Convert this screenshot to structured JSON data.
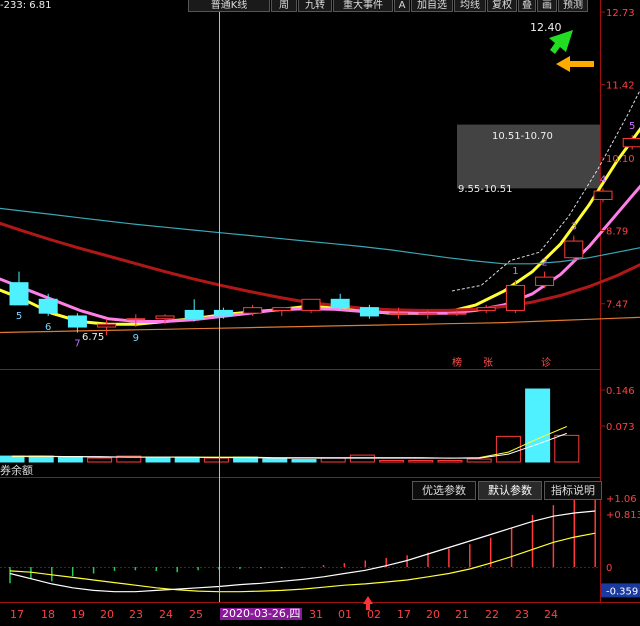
{
  "toolbar": {
    "price_display": "-233: 6.81",
    "buttons": [
      "普通K线",
      "周",
      "九转",
      "重大事件",
      "A",
      "加自选",
      "均线",
      "复权",
      "叠",
      "画",
      "预测"
    ]
  },
  "colors": {
    "bg": "#000000",
    "up": "#ff3b3b",
    "down": "#4ff0ff",
    "ma_yellow": "#ffff33",
    "ma_pink": "#ff7fe8",
    "ma_darkred": "#b01818",
    "ma_teal": "#3aa6b6",
    "ma_orange": "#e07a30",
    "axis_text": "#ff4040",
    "divider": "#a01010"
  },
  "chart_data": [
    {
      "type": "candlestick",
      "title": "",
      "ylim": [
        6.6,
        12.73
      ],
      "y_axis_labels": [
        "12.73",
        "11.42",
        "10.10",
        "8.79",
        "7.47"
      ],
      "y_ticks": [
        12.73,
        11.42,
        10.1,
        8.79,
        7.47
      ],
      "candles": [
        {
          "o": 7.85,
          "h": 8.05,
          "l": 7.45,
          "c": 7.45
        },
        {
          "o": 7.55,
          "h": 7.65,
          "l": 7.25,
          "c": 7.3
        },
        {
          "o": 7.25,
          "h": 7.3,
          "l": 6.95,
          "c": 7.05
        },
        {
          "o": 7.05,
          "h": 7.2,
          "l": 6.9,
          "c": 7.1
        },
        {
          "o": 7.2,
          "h": 7.28,
          "l": 7.05,
          "c": 7.2
        },
        {
          "o": 7.2,
          "h": 7.28,
          "l": 7.1,
          "c": 7.25
        },
        {
          "o": 7.35,
          "h": 7.55,
          "l": 7.15,
          "c": 7.2
        },
        {
          "o": 7.35,
          "h": 7.4,
          "l": 7.2,
          "c": 7.25
        },
        {
          "o": 7.3,
          "h": 7.45,
          "l": 7.25,
          "c": 7.4
        },
        {
          "o": 7.35,
          "h": 7.4,
          "l": 7.25,
          "c": 7.4
        },
        {
          "o": 7.35,
          "h": 7.5,
          "l": 7.3,
          "c": 7.55
        },
        {
          "o": 7.55,
          "h": 7.65,
          "l": 7.35,
          "c": 7.4
        },
        {
          "o": 7.4,
          "h": 7.45,
          "l": 7.2,
          "c": 7.25
        },
        {
          "o": 7.3,
          "h": 7.4,
          "l": 7.2,
          "c": 7.3
        },
        {
          "o": 7.3,
          "h": 7.35,
          "l": 7.2,
          "c": 7.3
        },
        {
          "o": 7.3,
          "h": 7.35,
          "l": 7.25,
          "c": 7.3
        },
        {
          "o": 7.35,
          "h": 7.45,
          "l": 7.3,
          "c": 7.4
        },
        {
          "o": 7.35,
          "h": 7.9,
          "l": 7.3,
          "c": 7.8
        },
        {
          "o": 7.8,
          "h": 8.05,
          "l": 7.75,
          "c": 7.95
        },
        {
          "o": 8.3,
          "h": 8.7,
          "l": 8.25,
          "c": 8.6
        },
        {
          "o": 9.35,
          "h": 9.55,
          "l": 9.3,
          "c": 9.5
        },
        {
          "o": 10.3,
          "h": 10.51,
          "l": 10.25,
          "c": 10.45
        },
        {
          "o": 11.05,
          "h": 11.55,
          "l": 10.9,
          "c": 11.5
        },
        {
          "o": 12.2,
          "h": 12.4,
          "l": 11.2,
          "c": 11.25
        },
        {
          "o": 11.35,
          "h": 11.85,
          "l": 11.1,
          "c": 11.45
        }
      ],
      "ma_series": [
        {
          "color": "#ffff33",
          "values": [
            7.75,
            7.55,
            7.3,
            7.15,
            7.1,
            7.1,
            7.15,
            7.2,
            7.27,
            7.32,
            7.36,
            7.42,
            7.4,
            7.34,
            7.3,
            7.3,
            7.32,
            7.45,
            7.7,
            8.05,
            8.55,
            9.25,
            10.05,
            10.75,
            11.1,
            11.45
          ]
        },
        {
          "color": "#ff7fe8",
          "values": [
            7.95,
            7.75,
            7.55,
            7.35,
            7.2,
            7.15,
            7.15,
            7.18,
            7.24,
            7.3,
            7.36,
            7.38,
            7.37,
            7.33,
            7.31,
            7.3,
            7.3,
            7.35,
            7.45,
            7.65,
            8.0,
            8.5,
            9.1,
            9.7,
            10.3,
            10.85
          ]
        },
        {
          "color": "#b01818",
          "values": [
            8.95,
            8.78,
            8.62,
            8.47,
            8.33,
            8.19,
            8.05,
            7.92,
            7.8,
            7.69,
            7.59,
            7.5,
            7.44,
            7.39,
            7.36,
            7.35,
            7.35,
            7.37,
            7.42,
            7.5,
            7.62,
            7.78,
            7.98,
            8.22,
            8.5,
            8.85
          ]
        },
        {
          "color": "#3aa6b6",
          "values": [
            9.2,
            9.14,
            9.08,
            9.02,
            8.96,
            8.9,
            8.85,
            8.8,
            8.75,
            8.7,
            8.65,
            8.6,
            8.55,
            8.5,
            8.44,
            8.37,
            8.3,
            8.24,
            8.19,
            8.19,
            8.23,
            8.3,
            8.4,
            8.5,
            8.62,
            8.78
          ]
        },
        {
          "color": "#e07a30",
          "values": [
            6.95,
            6.96,
            6.97,
            6.98,
            6.99,
            7.0,
            7.01,
            7.02,
            7.03,
            7.04,
            7.05,
            7.06,
            7.07,
            7.08,
            7.09,
            7.1,
            7.11,
            7.12,
            7.13,
            7.15,
            7.17,
            7.19,
            7.21,
            7.23,
            7.25,
            7.27
          ]
        }
      ],
      "count_labels": [
        {
          "i": 0,
          "text": "5",
          "pos": "below"
        },
        {
          "i": 1,
          "text": "6",
          "pos": "below"
        },
        {
          "i": 2,
          "text": "7",
          "pos": "below"
        },
        {
          "i": 4,
          "text": "9",
          "pos": "below"
        },
        {
          "i": 17,
          "text": "1",
          "pos": "above"
        },
        {
          "i": 18,
          "text": "2",
          "pos": "above"
        },
        {
          "i": 19,
          "text": "3",
          "pos": "above"
        },
        {
          "i": 20,
          "text": "4",
          "pos": "above"
        },
        {
          "i": 21,
          "text": "5",
          "pos": "above"
        },
        {
          "i": 22,
          "text": "6",
          "pos": "above"
        },
        {
          "i": 23,
          "text": "7",
          "pos": "above"
        }
      ],
      "annotations": {
        "high_label": "12.40",
        "low_label": "6.75",
        "gap_band_top": "10.51-10.70",
        "gap_band_bottom": "9.55-10.51",
        "gap_band_range": [
          9.55,
          10.7
        ],
        "markers": [
          "榜",
          "张",
          "诊"
        ]
      }
    },
    {
      "type": "bar",
      "title": "",
      "y_axis_labels": [
        "0.146",
        "0.073"
      ],
      "ylim": [
        0,
        0.146
      ],
      "bars": [
        {
          "v": 0.012,
          "up": false
        },
        {
          "v": 0.012,
          "up": false
        },
        {
          "v": 0.011,
          "up": false
        },
        {
          "v": 0.008,
          "up": true
        },
        {
          "v": 0.012,
          "up": true
        },
        {
          "v": 0.008,
          "up": false
        },
        {
          "v": 0.01,
          "up": false
        },
        {
          "v": 0.008,
          "up": true
        },
        {
          "v": 0.01,
          "up": false
        },
        {
          "v": 0.006,
          "up": false
        },
        {
          "v": 0.005,
          "up": false
        },
        {
          "v": 0.008,
          "up": true
        },
        {
          "v": 0.014,
          "up": true
        },
        {
          "v": 0.003,
          "up": true
        },
        {
          "v": 0.003,
          "up": true
        },
        {
          "v": 0.003,
          "up": true
        },
        {
          "v": 0.006,
          "up": true
        },
        {
          "v": 0.052,
          "up": true
        },
        {
          "v": 0.148,
          "up": false
        },
        {
          "v": 0.054,
          "up": true
        }
      ],
      "lines": [
        {
          "color": "#ffff33",
          "values": [
            0.011,
            0.011,
            0.011,
            0.01,
            0.01,
            0.01,
            0.01,
            0.01,
            0.01,
            0.009,
            0.009,
            0.009,
            0.009,
            0.009,
            0.009,
            0.008,
            0.009,
            0.02,
            0.047,
            0.072
          ]
        },
        {
          "color": "#ffffff",
          "values": [
            0.012,
            0.012,
            0.011,
            0.011,
            0.01,
            0.01,
            0.01,
            0.009,
            0.009,
            0.008,
            0.008,
            0.008,
            0.008,
            0.008,
            0.008,
            0.008,
            0.008,
            0.016,
            0.036,
            0.058
          ]
        }
      ]
    },
    {
      "type": "bar",
      "title": "",
      "y_axis_labels": [
        "+1.06",
        "+0.813",
        "0",
        "-0.359"
      ],
      "ylim": [
        -0.5,
        1.15
      ],
      "bars": [
        -0.25,
        -0.18,
        -0.22,
        -0.14,
        -0.1,
        -0.06,
        -0.05,
        -0.06,
        -0.08,
        -0.05,
        -0.04,
        -0.03,
        -0.02,
        -0.02,
        -0.01,
        0.03,
        0.06,
        0.1,
        0.14,
        0.18,
        0.22,
        0.28,
        0.35,
        0.45,
        0.6,
        0.8,
        0.95,
        1.1,
        1.15
      ],
      "lines": [
        {
          "color": "#ffff33",
          "values": [
            -0.06,
            -0.08,
            -0.12,
            -0.16,
            -0.2,
            -0.24,
            -0.28,
            -0.32,
            -0.35,
            -0.37,
            -0.38,
            -0.38,
            -0.37,
            -0.36,
            -0.34,
            -0.31,
            -0.28,
            -0.26,
            -0.23,
            -0.2,
            -0.15,
            -0.1,
            -0.03,
            0.06,
            0.16,
            0.27,
            0.38,
            0.46,
            0.52
          ]
        },
        {
          "color": "#ffffff",
          "values": [
            -0.1,
            -0.18,
            -0.26,
            -0.32,
            -0.36,
            -0.38,
            -0.38,
            -0.36,
            -0.34,
            -0.32,
            -0.3,
            -0.27,
            -0.25,
            -0.22,
            -0.19,
            -0.15,
            -0.1,
            -0.05,
            0.02,
            0.1,
            0.2,
            0.3,
            0.4,
            0.5,
            0.6,
            0.7,
            0.78,
            0.83,
            0.86
          ]
        }
      ]
    }
  ],
  "indicator": {
    "title": "券余额",
    "tabs": [
      "优选参数",
      "默认参数",
      "指标说明"
    ],
    "active_tab": 1
  },
  "x_axis": {
    "labels": [
      "17",
      "18",
      "19",
      "20",
      "23",
      "24",
      "25",
      "31",
      "01",
      "02",
      "17",
      "20",
      "21",
      "22",
      "23",
      "24"
    ],
    "crosshair_date": "2020-03-26,四"
  }
}
